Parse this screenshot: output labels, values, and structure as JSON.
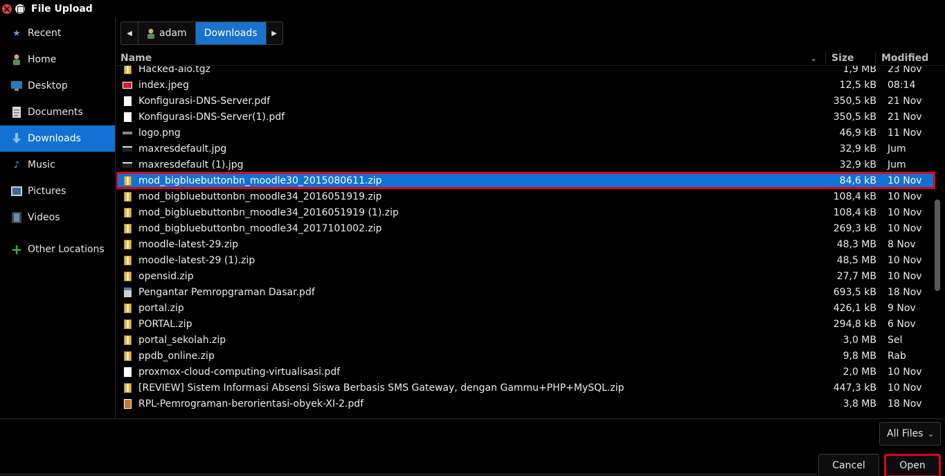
{
  "window": {
    "title": "File Upload"
  },
  "sidebar": {
    "items": [
      {
        "label": "Recent",
        "icon": "star-icon"
      },
      {
        "label": "Home",
        "icon": "home-icon"
      },
      {
        "label": "Desktop",
        "icon": "desktop-icon"
      },
      {
        "label": "Documents",
        "icon": "documents-icon"
      },
      {
        "label": "Downloads",
        "icon": "download-icon",
        "active": true
      },
      {
        "label": "Music",
        "icon": "music-icon"
      },
      {
        "label": "Pictures",
        "icon": "pictures-icon"
      },
      {
        "label": "Videos",
        "icon": "videos-icon"
      },
      {
        "label": "Other Locations",
        "icon": "plus-icon"
      }
    ]
  },
  "pathbar": {
    "home": "adam",
    "current": "Downloads"
  },
  "list": {
    "headers": {
      "name": "Name",
      "size": "Size",
      "modified": "Modified"
    },
    "rows": [
      {
        "name": "Hacked-aio.tgz",
        "size": "1,9 MB",
        "modified": "23 Nov",
        "type": "zip"
      },
      {
        "name": "index.jpeg",
        "size": "12,5 kB",
        "modified": "08:14",
        "type": "jpeg"
      },
      {
        "name": "Konfigurasi-DNS-Server.pdf",
        "size": "350,5 kB",
        "modified": "21 Nov",
        "type": "pdf"
      },
      {
        "name": "Konfigurasi-DNS-Server(1).pdf",
        "size": "350,5 kB",
        "modified": "21 Nov",
        "type": "pdf"
      },
      {
        "name": "logo.png",
        "size": "46,9 kB",
        "modified": "11 Nov",
        "type": "png"
      },
      {
        "name": "maxresdefault.jpg",
        "size": "32,9 kB",
        "modified": "Jum",
        "type": "jpgdark"
      },
      {
        "name": "maxresdefault (1).jpg",
        "size": "32,9 kB",
        "modified": "Jum",
        "type": "jpgdark"
      },
      {
        "name": "mod_bigbluebuttonbn_moodle30_2015080611.zip",
        "size": "84,6 kB",
        "modified": "10 Nov",
        "type": "zip",
        "selected": true
      },
      {
        "name": "mod_bigbluebuttonbn_moodle34_2016051919.zip",
        "size": "108,4 kB",
        "modified": "10 Nov",
        "type": "zip"
      },
      {
        "name": "mod_bigbluebuttonbn_moodle34_2016051919 (1).zip",
        "size": "108,4 kB",
        "modified": "10 Nov",
        "type": "zip"
      },
      {
        "name": "mod_bigbluebuttonbn_moodle34_2017101002.zip",
        "size": "269,3 kB",
        "modified": "10 Nov",
        "type": "zip"
      },
      {
        "name": "moodle-latest-29.zip",
        "size": "48,3 MB",
        "modified": "8 Nov",
        "type": "zip"
      },
      {
        "name": "moodle-latest-29 (1).zip",
        "size": "48,5 MB",
        "modified": "10 Nov",
        "type": "zip"
      },
      {
        "name": "opensid.zip",
        "size": "27,7 MB",
        "modified": "10 Nov",
        "type": "zip"
      },
      {
        "name": "Pengantar Pemropgraman Dasar.pdf",
        "size": "693,5 kB",
        "modified": "18 Nov",
        "type": "pdfimg"
      },
      {
        "name": "portal.zip",
        "size": "426,1 kB",
        "modified": "9 Nov",
        "type": "zip"
      },
      {
        "name": "PORTAL.zip",
        "size": "294,8 kB",
        "modified": "6 Nov",
        "type": "zip"
      },
      {
        "name": "portal_sekolah.zip",
        "size": "3,0 MB",
        "modified": "Sel",
        "type": "zip"
      },
      {
        "name": "ppdb_online.zip",
        "size": "9,8 MB",
        "modified": "Rab",
        "type": "zip"
      },
      {
        "name": "proxmox-cloud-computing-virtualisasi.pdf",
        "size": "2,0 MB",
        "modified": "10 Nov",
        "type": "pdf"
      },
      {
        "name": "[REVIEW] Sistem Informasi Absensi Siswa Berbasis SMS Gateway, dengan Gammu+PHP+MySQL.zip",
        "size": "447,3 kB",
        "modified": "10 Nov",
        "type": "zip"
      },
      {
        "name": "RPL-Pemrograman-berorientasi-obyek-XI-2.pdf",
        "size": "3,8 MB",
        "modified": "18 Nov",
        "type": "rpl"
      }
    ]
  },
  "filter": {
    "label": "All Files"
  },
  "buttons": {
    "cancel": "Cancel",
    "open": "Open"
  }
}
